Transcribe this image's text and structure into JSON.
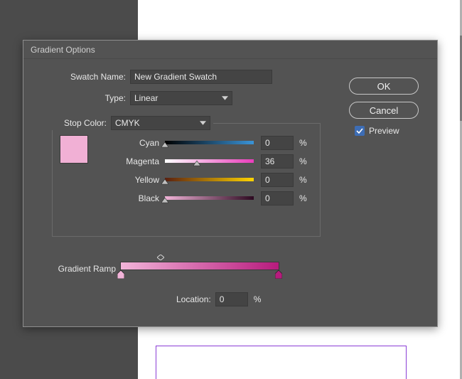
{
  "dialog": {
    "title": "Gradient Options",
    "swatch_name_label": "Swatch Name:",
    "swatch_name_value": "New Gradient Swatch",
    "type_label": "Type:",
    "type_value": "Linear",
    "stop_color_label": "Stop Color:",
    "stop_color_value": "CMYK",
    "swatch_color": "#f1b0d5",
    "sliders": {
      "cyan": {
        "label": "Cyan",
        "value": "0",
        "pos_pct": 0
      },
      "magenta": {
        "label": "Magenta",
        "value": "36",
        "pos_pct": 36
      },
      "yellow": {
        "label": "Yellow",
        "value": "0",
        "pos_pct": 0
      },
      "black": {
        "label": "Black",
        "value": "0",
        "pos_pct": 0
      }
    },
    "percent_sign": "%",
    "ramp_label": "Gradient Ramp",
    "ramp_colors": {
      "left": "#f2b4d9",
      "right": "#b71b7d"
    },
    "location_label": "Location:",
    "location_value": "0"
  },
  "buttons": {
    "ok": "OK",
    "cancel": "Cancel",
    "preview_label": "Preview",
    "preview_checked": true
  }
}
